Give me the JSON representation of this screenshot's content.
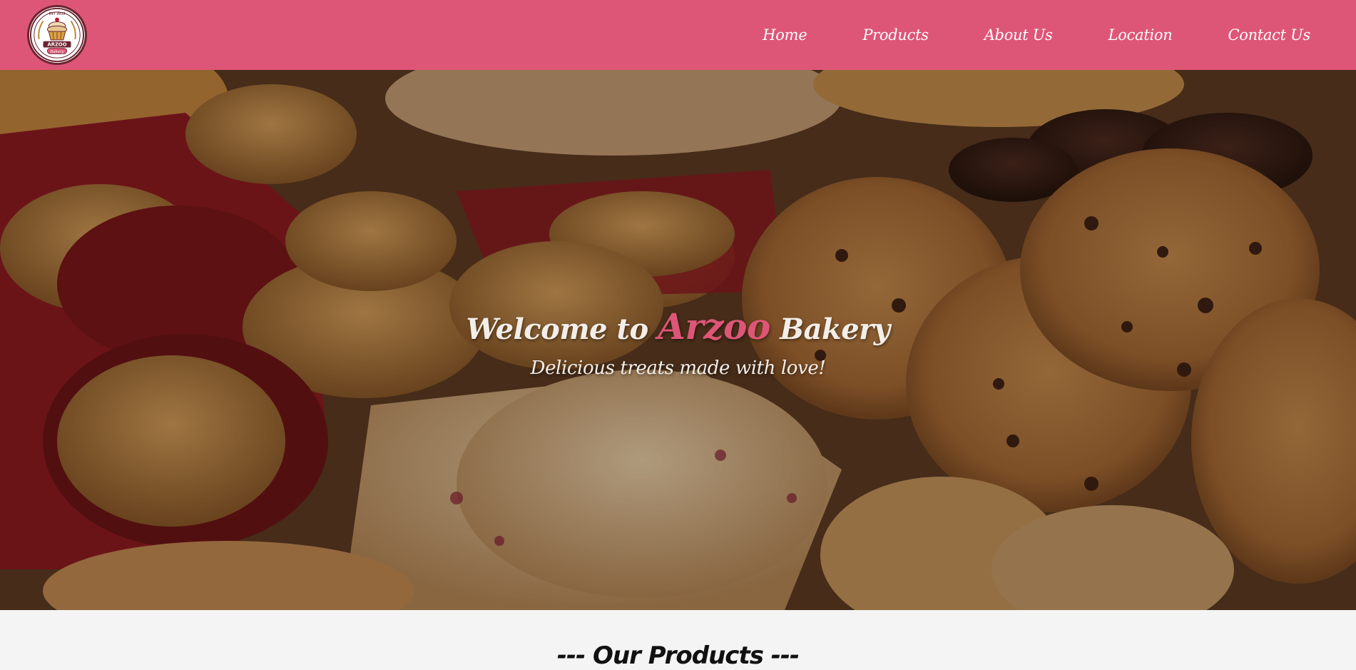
{
  "brand": {
    "logo_top_text": "EST 2018",
    "logo_name": "ARZOO",
    "logo_sub": "Bakery"
  },
  "nav": {
    "items": [
      {
        "label": "Home"
      },
      {
        "label": "Products"
      },
      {
        "label": "About Us"
      },
      {
        "label": "Location"
      },
      {
        "label": "Contact Us"
      }
    ]
  },
  "hero": {
    "title_prefix": "Welcome to ",
    "title_brand": "Arzoo",
    "title_suffix": " Bakery",
    "subtitle": "Delicious treats made with love!"
  },
  "products": {
    "heading": "--- Our Products ---"
  },
  "colors": {
    "nav_bg": "#de5677",
    "brand_accent": "#de5677",
    "hero_text": "#f3eee9",
    "page_bg": "#f4f4f4"
  }
}
